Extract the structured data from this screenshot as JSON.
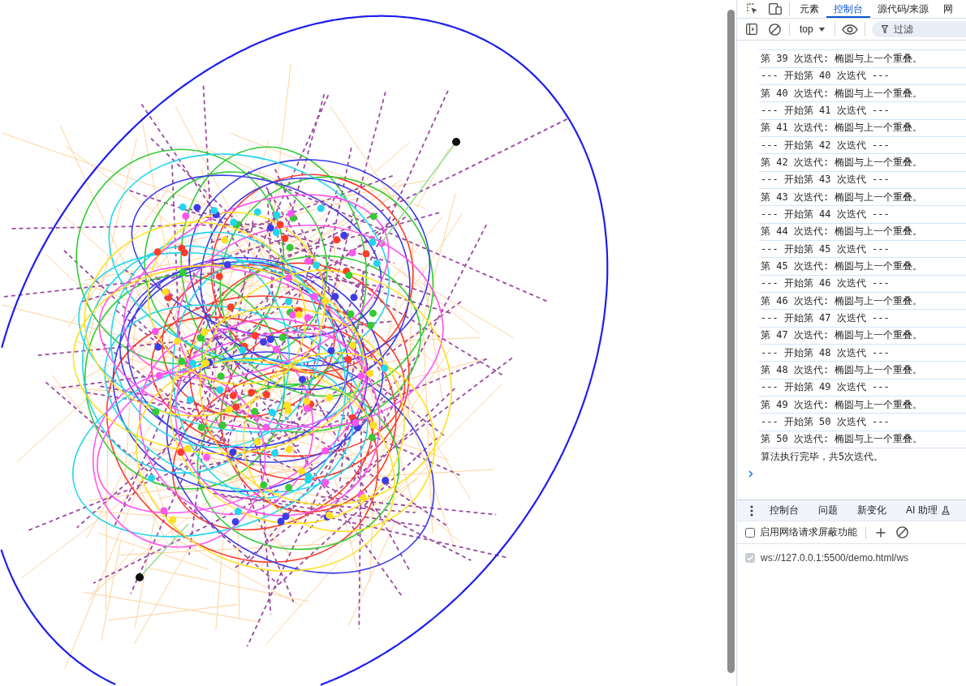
{
  "devtools": {
    "main_tabs": [
      {
        "label": "元素",
        "selected": false
      },
      {
        "label": "控制台",
        "selected": true
      },
      {
        "label": "源代码/来源",
        "selected": false
      },
      {
        "label": "网",
        "selected": false
      }
    ],
    "console_toolbar": {
      "context": "top",
      "filter": {
        "placeholder": "过滤"
      }
    },
    "console_messages": [
      "第 39 次迭代: 椭圆与上一个重叠。",
      "--- 开始第 40 次迭代 ---",
      "第 40 次迭代: 椭圆与上一个重叠。",
      "--- 开始第 41 次迭代 ---",
      "第 41 次迭代: 椭圆与上一个重叠。",
      "--- 开始第 42 次迭代 ---",
      "第 42 次迭代: 椭圆与上一个重叠。",
      "--- 开始第 43 次迭代 ---",
      "第 43 次迭代: 椭圆与上一个重叠。",
      "--- 开始第 44 次迭代 ---",
      "第 44 次迭代: 椭圆与上一个重叠。",
      "--- 开始第 45 次迭代 ---",
      "第 45 次迭代: 椭圆与上一个重叠。",
      "--- 开始第 46 次迭代 ---",
      "第 46 次迭代: 椭圆与上一个重叠。",
      "--- 开始第 47 次迭代 ---",
      "第 47 次迭代: 椭圆与上一个重叠。",
      "--- 开始第 48 次迭代 ---",
      "第 48 次迭代: 椭圆与上一个重叠。",
      "--- 开始第 49 次迭代 ---",
      "第 49 次迭代: 椭圆与上一个重叠。",
      "--- 开始第 50 次迭代 ---",
      "第 50 次迭代: 椭圆与上一个重叠。",
      "算法执行完毕，共5次迭代。"
    ],
    "drawer_tabs": [
      {
        "label": "控制台",
        "selected": false,
        "experimental": false
      },
      {
        "label": "问题",
        "selected": false,
        "experimental": false
      },
      {
        "label": "新变化",
        "selected": false,
        "experimental": false
      },
      {
        "label": "AI 助理",
        "selected": false,
        "experimental": true
      }
    ],
    "request_blocking": {
      "enable": {
        "label": "启用网络请求屏蔽功能",
        "checked": false
      },
      "patterns": [
        {
          "text": "ws://127.0.0.1:5500/demo.html/ws",
          "checked": true,
          "disabled": true
        }
      ]
    }
  }
}
